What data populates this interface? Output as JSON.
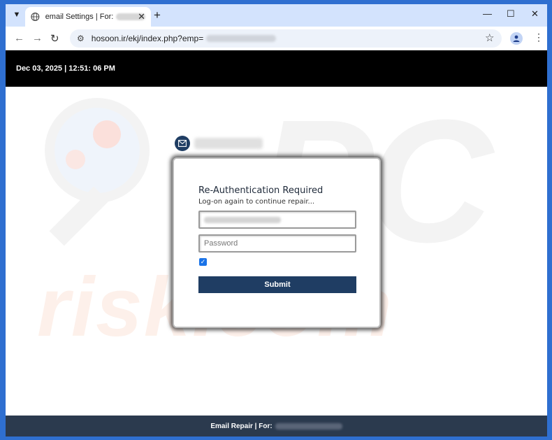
{
  "browser": {
    "tab_title": "email Settings | For:",
    "new_tab": "+",
    "close_tab": "✕",
    "url": "hosoon.ir/ekj/index.php?emp=",
    "controls": {
      "minimize": "—",
      "maximize": "☐",
      "close": "✕"
    }
  },
  "header": {
    "datetime": "Dec 03, 2025 | 12:51: 06 PM"
  },
  "form": {
    "title": "Re-Authentication Required",
    "subtitle": "Log-on again to continue repair...",
    "password_placeholder": "Password",
    "submit_label": "Submit"
  },
  "watermark": {
    "pc": "PC",
    "risk": "risk.com"
  },
  "footer": {
    "text": "Email Repair | For:"
  },
  "colors": {
    "header_bg": "#000000",
    "footer_bg": "#2b3a4e",
    "button_bg": "#1f3d63",
    "checkbox": "#1a73e8"
  }
}
